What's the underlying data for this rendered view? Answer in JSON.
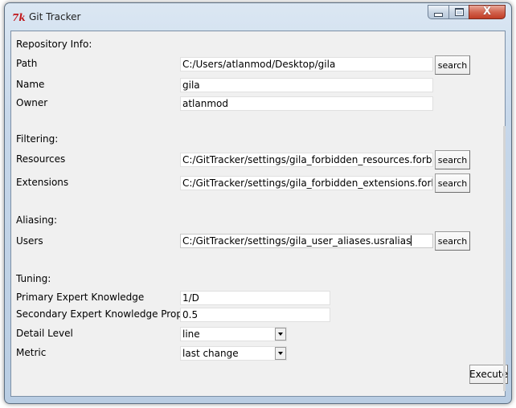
{
  "window": {
    "title": "Git Tracker",
    "app_icon_glyph": "7k",
    "controls": {
      "minimize_icon": "minimize-icon",
      "maximize_icon": "maximize-icon",
      "close_glyph": "X"
    }
  },
  "repository": {
    "section_label": "Repository Info:",
    "path_label": "Path",
    "path_value": "C:/Users/atlanmod/Desktop/gila",
    "path_button": "search",
    "name_label": "Name",
    "name_value": "gila",
    "owner_label": "Owner",
    "owner_value": "atlanmod"
  },
  "filtering": {
    "section_label": "Filtering:",
    "resources_label": "Resources",
    "resources_value": "C:/GitTracker/settings/gila_forbidden_resources.forbres",
    "resources_button": "search",
    "extensions_label": "Extensions",
    "extensions_value": "C:/GitTracker/settings/gila_forbidden_extensions.forbext",
    "extensions_button": "search"
  },
  "aliasing": {
    "section_label": "Aliasing:",
    "users_label": "Users",
    "users_value": "C:/GitTracker/settings/gila_user_aliases.usralias",
    "users_button": "search"
  },
  "tuning": {
    "section_label": "Tuning:",
    "primary_label": "Primary Expert Knowledge",
    "primary_value": "1/D",
    "secondary_label": "Secondary Expert Knowledge Prop.",
    "secondary_value": "0.5",
    "detail_label": "Detail Level",
    "detail_value": "line",
    "metric_label": "Metric",
    "metric_value": "last change"
  },
  "execute_button": "Execute"
}
